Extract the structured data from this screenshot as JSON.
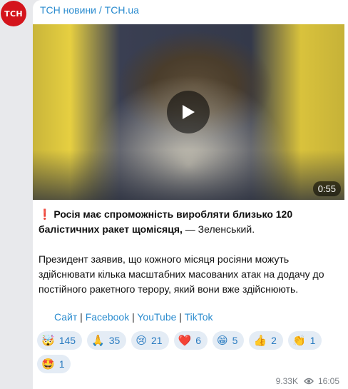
{
  "channel": {
    "avatar_text": "ТСН",
    "name": "ТСН новини / TCH.ua"
  },
  "video": {
    "duration": "0:55"
  },
  "post": {
    "exclamation": "❗",
    "headline_bold": "Росія має спроможність виробляти близько 120 балістичних ракет щомісяця,",
    "headline_rest": " — Зеленський.",
    "body": "Президент заявив, що кожного місяця росіяни можуть здійснювати кілька масштабних масованих атак на додачу до постійного ракетного терору, який вони вже здійснюють."
  },
  "links": [
    {
      "label": "Сайт"
    },
    {
      "label": "Facebook"
    },
    {
      "label": "YouTube"
    },
    {
      "label": "TikTok"
    }
  ],
  "link_separator": " | ",
  "reactions": [
    {
      "emoji": "🤯",
      "count": "145"
    },
    {
      "emoji": "🙏",
      "count": "35"
    },
    {
      "emoji": "😢",
      "count": "21"
    },
    {
      "emoji": "❤️",
      "count": "6"
    },
    {
      "emoji": "😁",
      "count": "5"
    },
    {
      "emoji": "👍",
      "count": "2"
    },
    {
      "emoji": "👏",
      "count": "1"
    },
    {
      "emoji": "🤩",
      "count": "1"
    }
  ],
  "meta": {
    "views": "9.33K",
    "time": "16:05"
  },
  "colors": {
    "accent": "#2b8ccf",
    "avatar_bg": "#d4141c",
    "reaction_bg": "#e4ecf5"
  }
}
